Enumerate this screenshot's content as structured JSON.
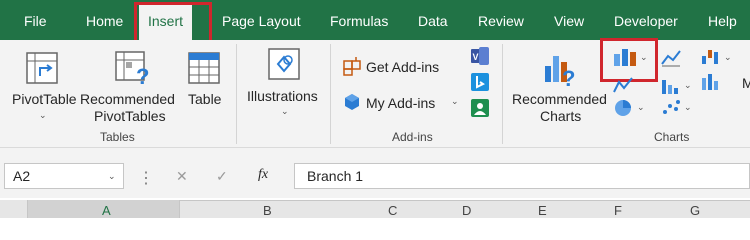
{
  "tabs": [
    "File",
    "Home",
    "Insert",
    "Page Layout",
    "Formulas",
    "Data",
    "Review",
    "View",
    "Developer",
    "Help"
  ],
  "active_tab": "Insert",
  "tables_group": {
    "pivottable": "PivotTable",
    "recommended_line1": "Recommended",
    "recommended_line2": "PivotTables",
    "table": "Table",
    "label": "Tables"
  },
  "illustrations_group": {
    "label": "Illustrations"
  },
  "addins_group": {
    "get_addins": "Get Add-ins",
    "my_addins": "My Add-ins",
    "label": "Add-ins"
  },
  "charts_group": {
    "recommended_line1": "Recommended",
    "recommended_line2": "Charts",
    "label": "Charts"
  },
  "formula_bar": {
    "name_box": "A2",
    "fx": "fx",
    "cancel": "✕",
    "enter": "✓",
    "content": "Branch 1"
  },
  "columns": [
    "A",
    "B",
    "C",
    "D",
    "E",
    "F",
    "G"
  ],
  "selected_column": "A",
  "colors": {
    "tab_bar": "#217346",
    "ribbon": "#f3f3f3",
    "highlight": "#d0262d"
  }
}
